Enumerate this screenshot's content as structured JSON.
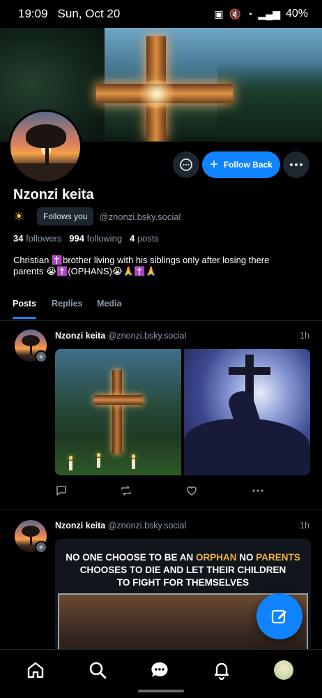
{
  "status_bar": {
    "time": "19:09",
    "date": "Sun, Oct 20",
    "battery": "40%"
  },
  "profile": {
    "name": "Nzonzi keita",
    "follows_you": "Follows you",
    "handle": "@znonzi.bsky.social",
    "followers_count": "34",
    "followers_label": "followers",
    "following_count": "994",
    "following_label": "following",
    "posts_count": "4",
    "posts_label": "posts",
    "bio_line1": "Christian ✝️brother living with his siblings only after losing there",
    "bio_line2": "parents 😭✝️(OPHANS)😭🙏✝️🙏"
  },
  "actions": {
    "follow_back": "Follow Back"
  },
  "tabs": [
    {
      "label": "Posts",
      "active": true
    },
    {
      "label": "Replies",
      "active": false
    },
    {
      "label": "Media",
      "active": false
    }
  ],
  "posts": [
    {
      "author": "Nzonzi keita",
      "handle": "@znonzi.bsky.social",
      "time": "1h"
    },
    {
      "author": "Nzonzi keita",
      "handle": "@znonzi.bsky.social",
      "time": "1h",
      "meme_line1_a": "NO ONE CHOOSE TO BE AN ",
      "meme_line1_b": "ORPHAN",
      "meme_line1_c": " NO ",
      "meme_line1_d": "PARENTS",
      "meme_line2": "CHOOSES TO DIE AND LET THEIR CHILDREN",
      "meme_line3": "TO FIGHT FOR THEMSELVES"
    }
  ],
  "icons": {
    "message": "message-icon",
    "more": "more-icon",
    "compose": "compose-icon",
    "home": "home-icon",
    "search": "search-icon",
    "chat": "chat-icon",
    "bell": "bell-icon"
  },
  "colors": {
    "accent": "#1083fe",
    "background": "#000000",
    "muted": "#8d9aa8"
  }
}
